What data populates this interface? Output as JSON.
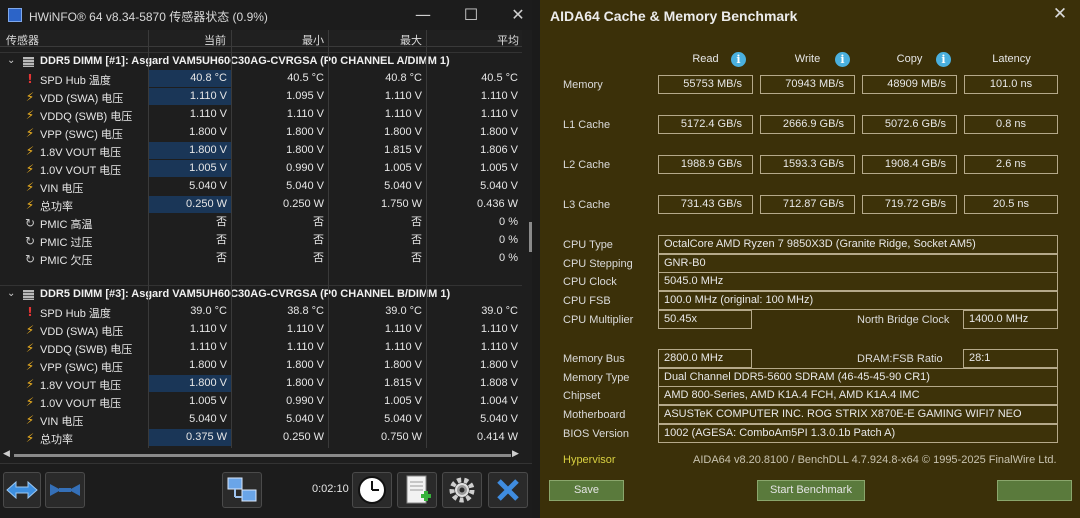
{
  "hwinfo": {
    "title": "HWiNFO® 64 v8.34-5870 传感器状态 (0.9%)",
    "window_controls": {
      "minimize": "—",
      "maximize": "☐",
      "close": "✕"
    },
    "columns": [
      "传感器",
      "当前",
      "最小",
      "最大",
      "平均"
    ],
    "groups": [
      {
        "name": "DDR5 DIMM [#1]: Asgard VAM5UH60C30AG-CVRGSA (P0 CHANNEL A/DIMM 1)",
        "rows": [
          {
            "icon": "thermometer-icon",
            "label": "SPD Hub 温度",
            "cur": "40.8 °C",
            "min": "40.5 °C",
            "max": "40.8 °C",
            "avg": "40.5 °C",
            "hl": true
          },
          {
            "icon": "bolt-icon",
            "label": "VDD (SWA) 电压",
            "cur": "1.110 V",
            "min": "1.095 V",
            "max": "1.110 V",
            "avg": "1.110 V",
            "hl": true
          },
          {
            "icon": "bolt-icon",
            "label": "VDDQ (SWB) 电压",
            "cur": "1.110 V",
            "min": "1.110 V",
            "max": "1.110 V",
            "avg": "1.110 V",
            "hl": false
          },
          {
            "icon": "bolt-icon",
            "label": "VPP (SWC) 电压",
            "cur": "1.800 V",
            "min": "1.800 V",
            "max": "1.800 V",
            "avg": "1.800 V",
            "hl": false
          },
          {
            "icon": "bolt-icon",
            "label": "1.8V VOUT 电压",
            "cur": "1.800 V",
            "min": "1.800 V",
            "max": "1.815 V",
            "avg": "1.806 V",
            "hl": true
          },
          {
            "icon": "bolt-icon",
            "label": "1.0V VOUT 电压",
            "cur": "1.005 V",
            "min": "0.990 V",
            "max": "1.005 V",
            "avg": "1.005 V",
            "hl": true
          },
          {
            "icon": "bolt-icon",
            "label": "VIN 电压",
            "cur": "5.040 V",
            "min": "5.040 V",
            "max": "5.040 V",
            "avg": "5.040 V",
            "hl": false
          },
          {
            "icon": "bolt-icon",
            "label": "总功率",
            "cur": "0.250 W",
            "min": "0.250 W",
            "max": "1.750 W",
            "avg": "0.436 W",
            "hl": true
          },
          {
            "icon": "pmic-icon",
            "label": "PMIC 高温",
            "cur": "否",
            "min": "否",
            "max": "否",
            "avg": "0 %",
            "hl": false
          },
          {
            "icon": "pmic-icon",
            "label": "PMIC 过压",
            "cur": "否",
            "min": "否",
            "max": "否",
            "avg": "0 %",
            "hl": false
          },
          {
            "icon": "pmic-icon",
            "label": "PMIC 欠压",
            "cur": "否",
            "min": "否",
            "max": "否",
            "avg": "0 %",
            "hl": false
          }
        ]
      },
      {
        "name": "DDR5 DIMM [#3]: Asgard VAM5UH60C30AG-CVRGSA (P0 CHANNEL B/DIMM 1)",
        "rows": [
          {
            "icon": "thermometer-icon",
            "label": "SPD Hub 温度",
            "cur": "39.0 °C",
            "min": "38.8 °C",
            "max": "39.0 °C",
            "avg": "39.0 °C",
            "hl": false
          },
          {
            "icon": "bolt-icon",
            "label": "VDD (SWA) 电压",
            "cur": "1.110 V",
            "min": "1.110 V",
            "max": "1.110 V",
            "avg": "1.110 V",
            "hl": false
          },
          {
            "icon": "bolt-icon",
            "label": "VDDQ (SWB) 电压",
            "cur": "1.110 V",
            "min": "1.110 V",
            "max": "1.110 V",
            "avg": "1.110 V",
            "hl": false
          },
          {
            "icon": "bolt-icon",
            "label": "VPP (SWC) 电压",
            "cur": "1.800 V",
            "min": "1.800 V",
            "max": "1.800 V",
            "avg": "1.800 V",
            "hl": false
          },
          {
            "icon": "bolt-icon",
            "label": "1.8V VOUT 电压",
            "cur": "1.800 V",
            "min": "1.800 V",
            "max": "1.815 V",
            "avg": "1.808 V",
            "hl": true
          },
          {
            "icon": "bolt-icon",
            "label": "1.0V VOUT 电压",
            "cur": "1.005 V",
            "min": "0.990 V",
            "max": "1.005 V",
            "avg": "1.004 V",
            "hl": false
          },
          {
            "icon": "bolt-icon",
            "label": "VIN 电压",
            "cur": "5.040 V",
            "min": "5.040 V",
            "max": "5.040 V",
            "avg": "5.040 V",
            "hl": false
          },
          {
            "icon": "bolt-icon",
            "label": "总功率",
            "cur": "0.375 W",
            "min": "0.250 W",
            "max": "0.750 W",
            "avg": "0.414 W",
            "hl": true
          }
        ]
      }
    ],
    "timer": "0:02:10"
  },
  "aida": {
    "title": "AIDA64 Cache & Memory Benchmark",
    "close": "✕",
    "columns": [
      "Read",
      "Write",
      "Copy",
      "Latency"
    ],
    "bench_rows": [
      {
        "label": "Memory",
        "read": "55753 MB/s",
        "write": "70943 MB/s",
        "copy": "48909 MB/s",
        "latency": "101.0 ns"
      },
      {
        "label": "L1 Cache",
        "read": "5172.4 GB/s",
        "write": "2666.9 GB/s",
        "copy": "5072.6 GB/s",
        "latency": "0.8 ns"
      },
      {
        "label": "L2 Cache",
        "read": "1988.9 GB/s",
        "write": "1593.3 GB/s",
        "copy": "1908.4 GB/s",
        "latency": "2.6 ns"
      },
      {
        "label": "L3 Cache",
        "read": "731.43 GB/s",
        "write": "712.87 GB/s",
        "copy": "719.72 GB/s",
        "latency": "20.5 ns"
      }
    ],
    "cpu_type_label": "CPU Type",
    "cpu_type": "OctalCore AMD Ryzen 7 9850X3D  (Granite Ridge, Socket AM5)",
    "cpu_stepping_label": "CPU Stepping",
    "cpu_stepping": "GNR-B0",
    "cpu_clock_label": "CPU Clock",
    "cpu_clock": "5045.0 MHz",
    "cpu_fsb_label": "CPU FSB",
    "cpu_fsb": "100.0 MHz  (original: 100 MHz)",
    "cpu_multiplier_label": "CPU Multiplier",
    "cpu_multiplier": "50.45x",
    "nb_clock_label": "North Bridge Clock",
    "nb_clock": "1400.0 MHz",
    "memory_bus_label": "Memory Bus",
    "memory_bus": "2800.0 MHz",
    "dram_fsb_label": "DRAM:FSB Ratio",
    "dram_fsb": "28:1",
    "memory_type_label": "Memory Type",
    "memory_type": "Dual Channel DDR5-5600 SDRAM  (46-45-45-90 CR1)",
    "chipset_label": "Chipset",
    "chipset": "AMD 800-Series, AMD K1A.4 FCH, AMD K1A.4 IMC",
    "motherboard_label": "Motherboard",
    "motherboard": "ASUSTeK COMPUTER INC. ROG STRIX X870E-E GAMING WIFI7 NEO",
    "bios_label": "BIOS Version",
    "bios": "1002  (AGESA: ComboAm5PI 1.3.0.1b Patch A)",
    "hypervisor_label": "Hypervisor",
    "version": "AIDA64 v8.20.8100 / BenchDLL 4.7.924.8-x64  © 1995-2025 FinalWire Ltd.",
    "save_label": "Save",
    "start_label": "Start Benchmark",
    "colors": {
      "background": "#3b3009",
      "accent_button": "#5a7a3c",
      "info_icon": "#4ab0df"
    }
  }
}
